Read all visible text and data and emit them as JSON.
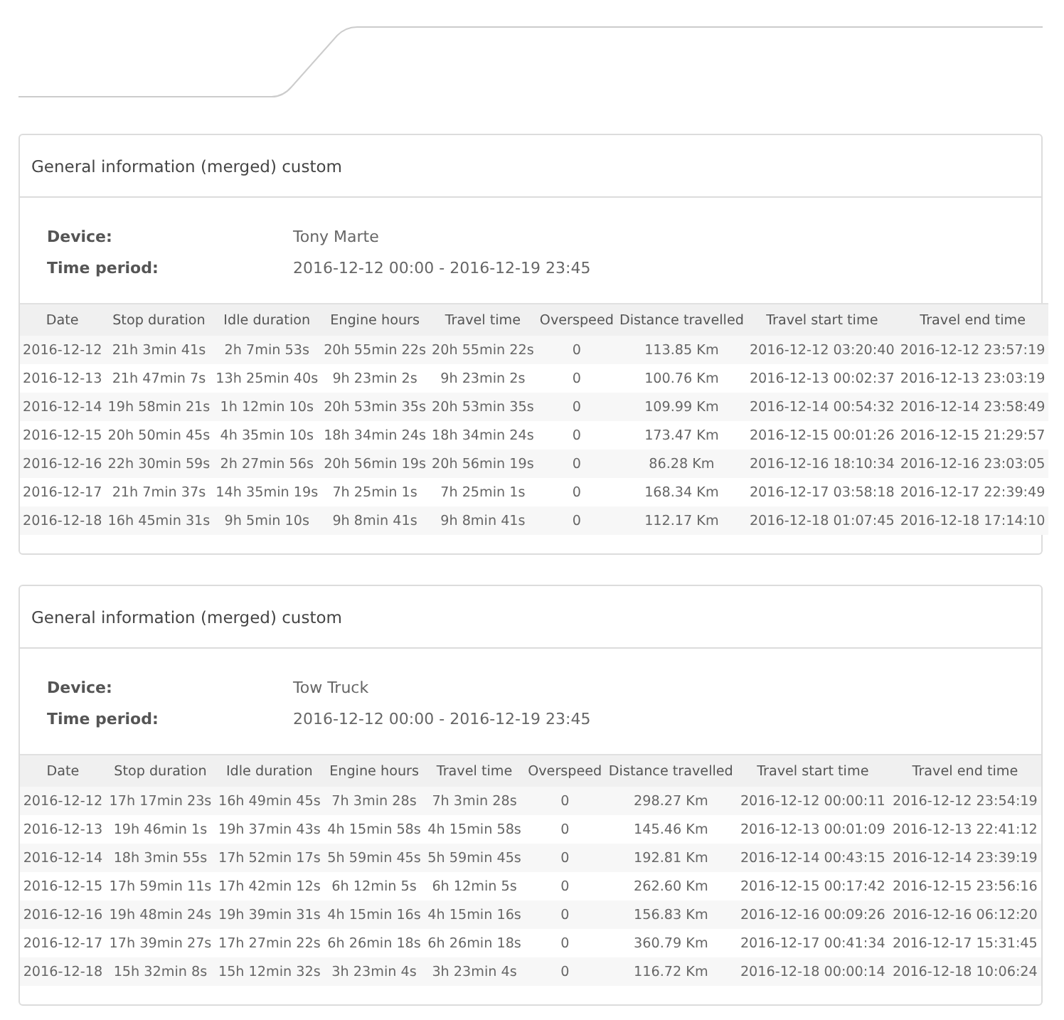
{
  "reports": [
    {
      "title": "General information (merged) custom",
      "info": [
        {
          "label": "Device:",
          "value": "Tony Marte"
        },
        {
          "label": "Time period:",
          "value": "2016-12-12 00:00 - 2016-12-19 23:45"
        }
      ],
      "columns": [
        "Date",
        "Stop duration",
        "Idle duration",
        "Engine hours",
        "Travel time",
        "Overspeed",
        "Distance travelled",
        "Travel start time",
        "Travel end time"
      ],
      "rows": [
        [
          "2016-12-12",
          "21h 3min 41s",
          "2h 7min 53s",
          "20h 55min 22s",
          "20h 55min 22s",
          "0",
          "113.85 Km",
          "2016-12-12 03:20:40",
          "2016-12-12 23:57:19"
        ],
        [
          "2016-12-13",
          "21h 47min 7s",
          "13h 25min 40s",
          "9h 23min 2s",
          "9h 23min 2s",
          "0",
          "100.76 Km",
          "2016-12-13 00:02:37",
          "2016-12-13 23:03:19"
        ],
        [
          "2016-12-14",
          "19h 58min 21s",
          "1h 12min 10s",
          "20h 53min 35s",
          "20h 53min 35s",
          "0",
          "109.99 Km",
          "2016-12-14 00:54:32",
          "2016-12-14 23:58:49"
        ],
        [
          "2016-12-15",
          "20h 50min 45s",
          "4h 35min 10s",
          "18h 34min 24s",
          "18h 34min 24s",
          "0",
          "173.47 Km",
          "2016-12-15 00:01:26",
          "2016-12-15 21:29:57"
        ],
        [
          "2016-12-16",
          "22h 30min 59s",
          "2h 27min 56s",
          "20h 56min 19s",
          "20h 56min 19s",
          "0",
          "86.28 Km",
          "2016-12-16 18:10:34",
          "2016-12-16 23:03:05"
        ],
        [
          "2016-12-17",
          "21h 7min 37s",
          "14h 35min 19s",
          "7h 25min 1s",
          "7h 25min 1s",
          "0",
          "168.34 Km",
          "2016-12-17 03:58:18",
          "2016-12-17 22:39:49"
        ],
        [
          "2016-12-18",
          "16h 45min 31s",
          "9h 5min 10s",
          "9h 8min 41s",
          "9h 8min 41s",
          "0",
          "112.17 Km",
          "2016-12-18 01:07:45",
          "2016-12-18 17:14:10"
        ]
      ]
    },
    {
      "title": "General information (merged) custom",
      "info": [
        {
          "label": "Device:",
          "value": "Tow Truck"
        },
        {
          "label": "Time period:",
          "value": "2016-12-12 00:00 - 2016-12-19 23:45"
        }
      ],
      "columns": [
        "Date",
        "Stop duration",
        "Idle duration",
        "Engine hours",
        "Travel time",
        "Overspeed",
        "Distance travelled",
        "Travel start time",
        "Travel end time"
      ],
      "rows": [
        [
          "2016-12-12",
          "17h 17min 23s",
          "16h 49min 45s",
          "7h 3min 28s",
          "7h 3min 28s",
          "0",
          "298.27 Km",
          "2016-12-12 00:00:11",
          "2016-12-12 23:54:19"
        ],
        [
          "2016-12-13",
          "19h 46min 1s",
          "19h 37min 43s",
          "4h 15min 58s",
          "4h 15min 58s",
          "0",
          "145.46 Km",
          "2016-12-13 00:01:09",
          "2016-12-13 22:41:12"
        ],
        [
          "2016-12-14",
          "18h 3min 55s",
          "17h 52min 17s",
          "5h 59min 45s",
          "5h 59min 45s",
          "0",
          "192.81 Km",
          "2016-12-14 00:43:15",
          "2016-12-14 23:39:19"
        ],
        [
          "2016-12-15",
          "17h 59min 11s",
          "17h 42min 12s",
          "6h 12min 5s",
          "6h 12min 5s",
          "0",
          "262.60 Km",
          "2016-12-15 00:17:42",
          "2016-12-15 23:56:16"
        ],
        [
          "2016-12-16",
          "19h 48min 24s",
          "19h 39min 31s",
          "4h 15min 16s",
          "4h 15min 16s",
          "0",
          "156.83 Km",
          "2016-12-16 00:09:26",
          "2016-12-16 06:12:20"
        ],
        [
          "2016-12-17",
          "17h 39min 27s",
          "17h 27min 22s",
          "6h 26min 18s",
          "6h 26min 18s",
          "0",
          "360.79 Km",
          "2016-12-17 00:41:34",
          "2016-12-17 15:31:45"
        ],
        [
          "2016-12-18",
          "15h 32min 8s",
          "15h 12min 32s",
          "3h 23min 4s",
          "3h 23min 4s",
          "0",
          "116.72 Km",
          "2016-12-18 00:00:14",
          "2016-12-18 10:06:24"
        ]
      ]
    }
  ]
}
